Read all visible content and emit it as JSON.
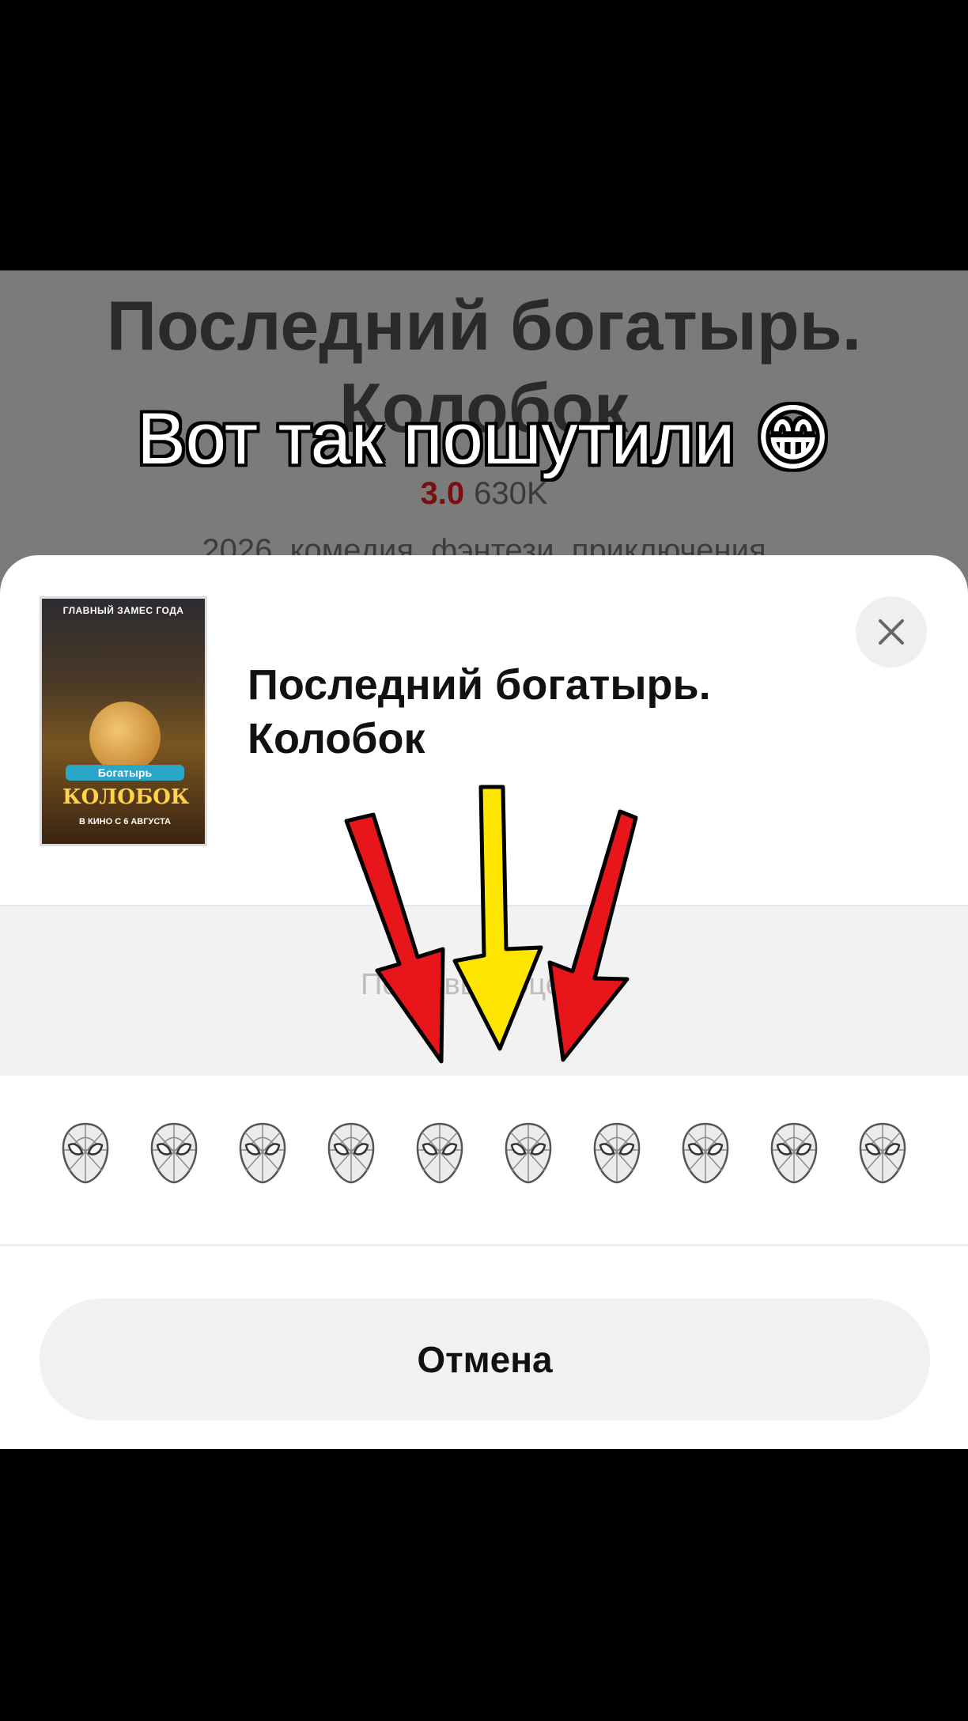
{
  "background_page": {
    "title": "Последний богатырь. Колобок",
    "rating_score": "3.0",
    "rating_count": "630K",
    "genres": "2026, комедия, фэнтези, приключения"
  },
  "caption": {
    "text": "Вот так пошутили 😁"
  },
  "sheet": {
    "poster": {
      "top_text": "ГЛАВНЫЙ ЗАМЕС ГОДА",
      "logo_line1": "Богатырь",
      "logo_line2": "КОЛОБОК",
      "date_text": "В КИНО С 6 АВГУСТА"
    },
    "title": "Последний богатырь. Колобок",
    "close_icon": "close-icon",
    "prompt": "Поставьте оценку",
    "rating_icon": "spider-mask-icon",
    "rating_count": 10,
    "cancel_label": "Отмена"
  },
  "colors": {
    "score": "#7a0f0f",
    "arrow_red": "#e8161b",
    "arrow_yellow": "#ffe600"
  }
}
